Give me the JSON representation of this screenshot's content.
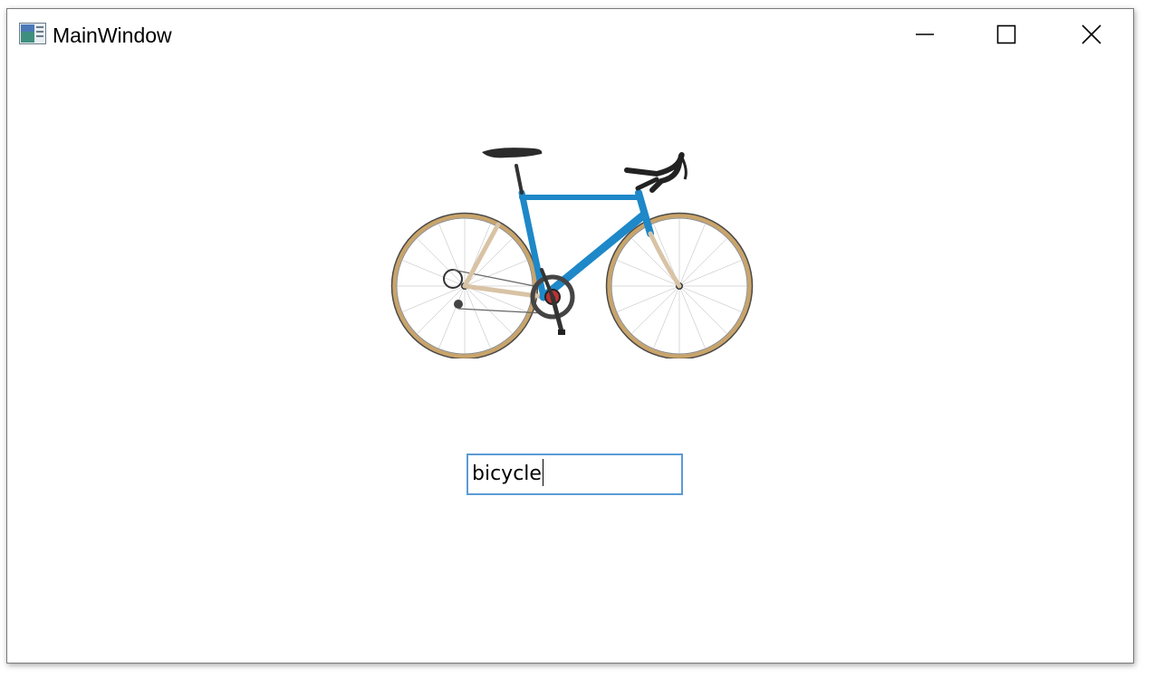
{
  "window": {
    "title": "MainWindow",
    "app_icon": "window-app-icon",
    "buttons": {
      "minimize_icon": "minimize-icon",
      "maximize_icon": "maximize-icon",
      "close_icon": "close-icon"
    }
  },
  "main": {
    "image": {
      "subject": "bicycle-image"
    },
    "input": {
      "value": "bicycle"
    }
  },
  "colors": {
    "input_border": "#5b9bd5",
    "frame_blue": "#1e88c8",
    "tire_tan": "#c9a46a"
  }
}
